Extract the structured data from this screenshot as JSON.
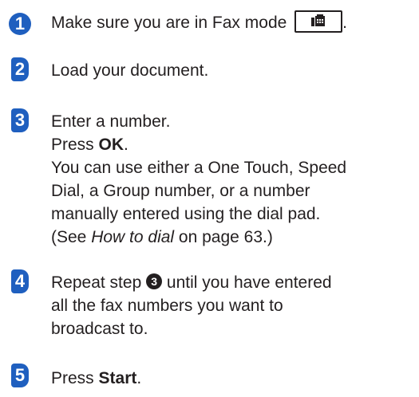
{
  "steps": [
    {
      "number": "1",
      "text_before": "Make sure you are in Fax mode",
      "icon": "fax-mode-key-icon",
      "text_after": "."
    },
    {
      "number": "2",
      "text": "Load your document."
    },
    {
      "number": "3",
      "line1": "Enter a number.",
      "line2_prefix": "Press ",
      "line2_key": "OK",
      "line2_suffix": ".",
      "line3": "You can use either a One Touch, Speed",
      "line4": "Dial, a Group number, or a number",
      "line5": "manually entered using the dial pad.",
      "line6_prefix": "(See ",
      "line6_link": "How to dial",
      "line6_suffix": " on page 63.)"
    },
    {
      "number": "4",
      "line1_prefix": "Repeat step ",
      "step_ref": "3",
      "line1_suffix": " until you have entered",
      "line2": "all the fax numbers you want to",
      "line3": "broadcast to."
    },
    {
      "number": "5",
      "prefix": "Press ",
      "key": "Start",
      "suffix": "."
    }
  ],
  "colors": {
    "step_badge": "#1f5fbf",
    "text": "#231f20"
  }
}
